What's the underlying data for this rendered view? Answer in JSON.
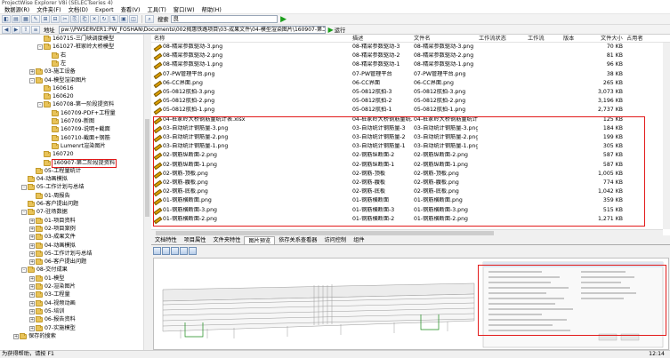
{
  "window": {
    "title": "ProjectWise Explorer V8i (SELECTseries 4)"
  },
  "menu": [
    "数据源(R)",
    "文件夹(F)",
    "文档(D)",
    "Export",
    "查看(V)",
    "工具(T)",
    "窗口(W)",
    "帮助(H)"
  ],
  "toolbar": {
    "search_label": "搜索",
    "search_value": "良"
  },
  "address": {
    "label": "地址",
    "value": "pw:\\\\PWSERVER1:PW_FOSHAN\\Documents\\002揭惠铁路项目\\03-成果文件\\04-模型渲染图片\\160907-第二...",
    "run_label": "运行"
  },
  "tree": [
    {
      "label": "160715-三门峡调度模型",
      "level": 4,
      "toggle": ""
    },
    {
      "label": "161027-桩家岭大桥模型",
      "level": 4,
      "toggle": "-"
    },
    {
      "label": "右",
      "level": 5,
      "toggle": ""
    },
    {
      "label": "左",
      "level": 5,
      "toggle": ""
    },
    {
      "label": "03-施工设备",
      "level": 3,
      "toggle": "+"
    },
    {
      "label": "04-模型渲染图片",
      "level": 3,
      "toggle": "-"
    },
    {
      "label": "160616",
      "level": 4,
      "toggle": ""
    },
    {
      "label": "160620",
      "level": 4,
      "toggle": ""
    },
    {
      "label": "160708-第一阶段提资料",
      "level": 4,
      "toggle": "-"
    },
    {
      "label": "160709-PDF+工程量",
      "level": 5,
      "toggle": ""
    },
    {
      "label": "160709-新图",
      "level": 5,
      "toggle": ""
    },
    {
      "label": "160709-说明+截面",
      "level": 5,
      "toggle": ""
    },
    {
      "label": "160710-截面+钢筋",
      "level": 5,
      "toggle": ""
    },
    {
      "label": "Lumenrt渲染图片",
      "level": 5,
      "toggle": ""
    },
    {
      "label": "160720",
      "level": 4,
      "toggle": ""
    },
    {
      "label": "160907-第二阶段提资料",
      "level": 4,
      "toggle": "",
      "selected": true
    },
    {
      "label": "05-工程量统计",
      "level": 3,
      "toggle": ""
    },
    {
      "label": "04-动画模拟",
      "level": 2,
      "toggle": ""
    },
    {
      "label": "05-工作计划与总结",
      "level": 2,
      "toggle": "-"
    },
    {
      "label": "01-周报告",
      "level": 3,
      "toggle": ""
    },
    {
      "label": "06-客户提出问题",
      "level": 2,
      "toggle": ""
    },
    {
      "label": "07-驻场数据",
      "level": 2,
      "toggle": "-"
    },
    {
      "label": "01-项目资料",
      "level": 3,
      "toggle": "+"
    },
    {
      "label": "02-项目案例",
      "level": 3,
      "toggle": "+"
    },
    {
      "label": "03-成果文件",
      "level": 3,
      "toggle": "+"
    },
    {
      "label": "04-动画模拟",
      "level": 3,
      "toggle": "+"
    },
    {
      "label": "05-工作计划与总结",
      "level": 3,
      "toggle": "+"
    },
    {
      "label": "06-客户提出问题",
      "level": 3,
      "toggle": "+"
    },
    {
      "label": "08-交付成果",
      "level": 2,
      "toggle": "-"
    },
    {
      "label": "01-模型",
      "level": 3,
      "toggle": "+"
    },
    {
      "label": "02-渲染图片",
      "level": 3,
      "toggle": "+"
    },
    {
      "label": "03-工程量",
      "level": 3,
      "toggle": "+"
    },
    {
      "label": "04-视频动画",
      "level": 3,
      "toggle": "+"
    },
    {
      "label": "05-培训",
      "level": 3,
      "toggle": "+"
    },
    {
      "label": "06-报告资料",
      "level": 3,
      "toggle": "+"
    },
    {
      "label": "07-实施模型",
      "level": 3,
      "toggle": "+"
    },
    {
      "label": "保存的搜索",
      "level": 1,
      "toggle": "+"
    }
  ],
  "columns": [
    "名称",
    "描述",
    "文件名",
    "工作流状态",
    "工作流",
    "版本",
    "文件大小",
    "占用者"
  ],
  "files": [
    {
      "name": "08-精梁参数驱动-3.png",
      "desc": "08-精梁参数驱动-3",
      "file": "08-精梁参数驱动-3.png",
      "size": "70 KB"
    },
    {
      "name": "08-精梁参数驱动-2.png",
      "desc": "08-精梁参数驱动-2",
      "file": "08-精梁参数驱动-2.png",
      "size": "81 KB"
    },
    {
      "name": "08-精梁参数驱动-1.png",
      "desc": "08-精梁参数驱动-1",
      "file": "08-精梁参数驱动-1.png",
      "size": "96 KB"
    },
    {
      "name": "07-PW管理平台.png",
      "desc": "07-PW管理平台",
      "file": "07-PW管理平台.png",
      "size": "38 KB"
    },
    {
      "name": "06-CC界面.png",
      "desc": "06-CC界面",
      "file": "06-CC界面.png",
      "size": "265 KB"
    },
    {
      "name": "05-0812航拍-3.png",
      "desc": "05-0812航拍-3",
      "file": "05-0812航拍-3.png",
      "size": "3,073 KB"
    },
    {
      "name": "05-0812航拍-2.png",
      "desc": "05-0812航拍-2",
      "file": "05-0812航拍-2.png",
      "size": "3,196 KB"
    },
    {
      "name": "05-0812航拍-1.png",
      "desc": "05-0812航拍-1",
      "file": "05-0812航拍-1.png",
      "size": "2,737 KB"
    },
    {
      "name": "04-桩家岭大桥钢筋量统计表.xlsx",
      "desc": "04-桩家岭大桥钢筋量统...",
      "file": "04-桩家岭大桥钢筋量统计表.xlsx",
      "size": "125 KB"
    },
    {
      "name": "03-自动统计钢筋量-3.png",
      "desc": "03-自动统计钢筋量-3",
      "file": "03-自动统计钢筋量-3.png",
      "size": "184 KB"
    },
    {
      "name": "03-自动统计钢筋量-2.png",
      "desc": "03-自动统计钢筋量-2",
      "file": "03-自动统计钢筋量-2.png",
      "size": "199 KB"
    },
    {
      "name": "03-自动统计钢筋量-1.png",
      "desc": "03-自动统计钢筋量-1",
      "file": "03-自动统计钢筋量-1.png",
      "size": "305 KB"
    },
    {
      "name": "02-钢筋纵断面-2.png",
      "desc": "02-钢筋纵断面-2",
      "file": "02-钢筋纵断面-2.png",
      "size": "587 KB"
    },
    {
      "name": "02-钢筋纵断面-1.png",
      "desc": "02-钢筋纵断面-1",
      "file": "02-钢筋纵断面-1.png",
      "size": "587 KB"
    },
    {
      "name": "02-钢筋-顶板.png",
      "desc": "02-钢筋-顶板",
      "file": "02-钢筋-顶板.png",
      "size": "1,005 KB"
    },
    {
      "name": "02-钢筋-腹板.png",
      "desc": "02-钢筋-腹板",
      "file": "02-钢筋-腹板.png",
      "size": "774 KB"
    },
    {
      "name": "02-钢筋-底板.png",
      "desc": "02-钢筋-底板",
      "file": "02-钢筋-底板.png",
      "size": "1,042 KB"
    },
    {
      "name": "01-钢筋横断面.png",
      "desc": "01-钢筋横断面",
      "file": "01-钢筋横断面.png",
      "size": "359 KB"
    },
    {
      "name": "01-钢筋横断面-3.png",
      "desc": "01-钢筋横断面-3",
      "file": "01-钢筋横断面-3.png",
      "size": "515 KB"
    },
    {
      "name": "01-钢筋横断面-2.png",
      "desc": "01-钢筋横断面-2",
      "file": "01-钢筋横断面-2.png",
      "size": "1,271 KB"
    }
  ],
  "tabs": [
    {
      "label": "文档特性"
    },
    {
      "label": "项目属性"
    },
    {
      "label": "文件夹特性"
    },
    {
      "label": "图片预览",
      "active": true
    },
    {
      "label": "依存关系查看器"
    },
    {
      "label": "访问控制"
    },
    {
      "label": "组件"
    }
  ],
  "status": {
    "help": "为获得帮助，请按 F1",
    "time": "12:14"
  },
  "colors": {
    "highlight": "#e21a1a",
    "folder": "#e8c35a",
    "go": "#1b9e1b"
  }
}
